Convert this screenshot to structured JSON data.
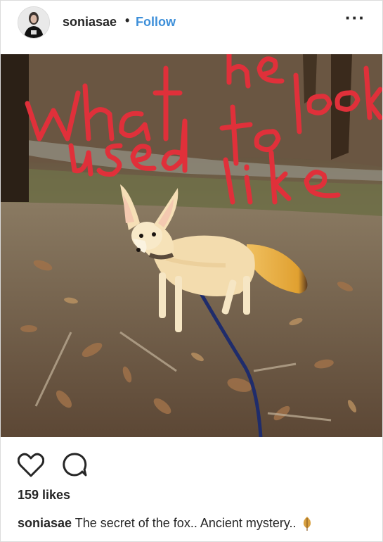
{
  "post": {
    "username": "soniasae",
    "separator": "•",
    "follow_label": "Follow",
    "more_icon": "more-horizontal-icon",
    "image": {
      "handwritten_overlay_text": "what he used to look like",
      "overlay_color": "#e0303a"
    },
    "actions": {
      "like_icon": "heart-outline-icon",
      "comment_icon": "speech-bubble-icon"
    },
    "likes_text": "159 likes",
    "caption": {
      "username": "soniasae",
      "text": "The secret of the fox.. Ancient mystery..",
      "emoji": "fallen-leaf-emoji"
    }
  },
  "colors": {
    "follow_blue": "#3d8fd9",
    "text": "#262626",
    "border": "#dbdbdb"
  }
}
